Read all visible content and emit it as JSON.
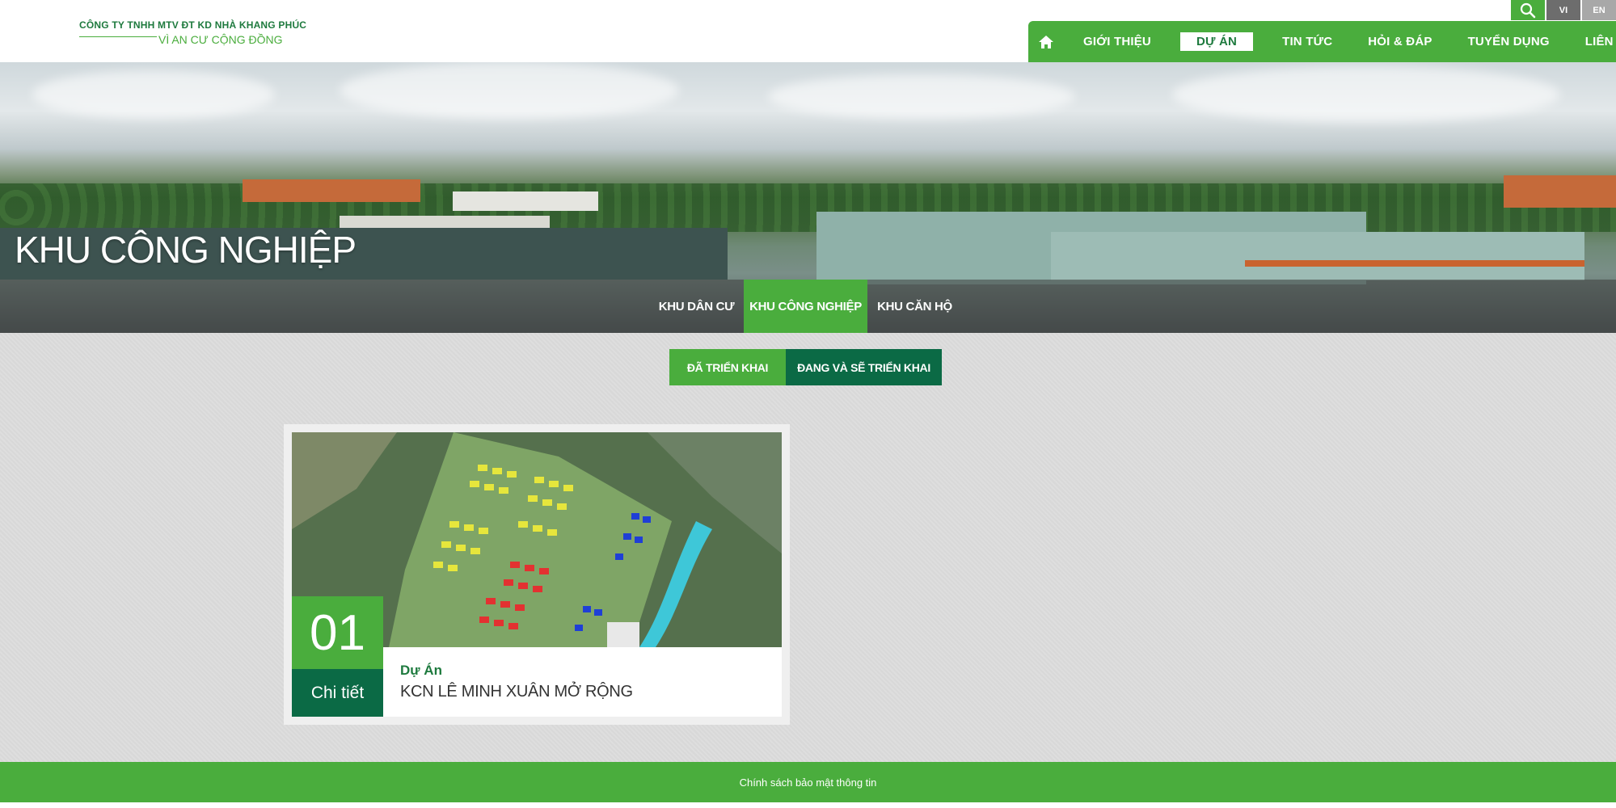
{
  "header": {
    "company_name": "CÔNG TY TNHH MTV ĐT KD NHÀ KHANG PHÚC",
    "slogan": "VÌ AN CƯ CỘNG ĐỒNG",
    "lang_vi": "VI",
    "lang_en": "EN"
  },
  "nav": {
    "items": [
      {
        "label": "GIỚI THIỆU"
      },
      {
        "label": "DỰ ÁN"
      },
      {
        "label": "TIN TỨC"
      },
      {
        "label": "HỎI & ĐÁP"
      },
      {
        "label": "TUYỂN DỤNG"
      },
      {
        "label": "LIÊN HỆ"
      }
    ],
    "active": "DỰ ÁN"
  },
  "banner": {
    "title": "KHU CÔNG NGHIỆP",
    "subnav": [
      {
        "label": "KHU DÂN CƯ"
      },
      {
        "label": "KHU CÔNG NGHIỆP"
      },
      {
        "label": "KHU CĂN HỘ"
      }
    ]
  },
  "filter": {
    "tabs": [
      {
        "label": "ĐÃ TRIỂN KHAI"
      },
      {
        "label": "ĐANG VÀ SẼ TRIỂN KHAI"
      }
    ]
  },
  "projects": [
    {
      "number": "01",
      "detail_label": "Chi tiết",
      "kicker": "Dự Án",
      "title": "KCN LÊ MINH XUÂN MỞ RỘNG"
    }
  ],
  "footer": {
    "link": "Chính sách bảo mật thông tin"
  },
  "colors": {
    "brand_green": "#4aad3d",
    "dark_green": "#0b6a45",
    "background": "#dcdcdc"
  }
}
